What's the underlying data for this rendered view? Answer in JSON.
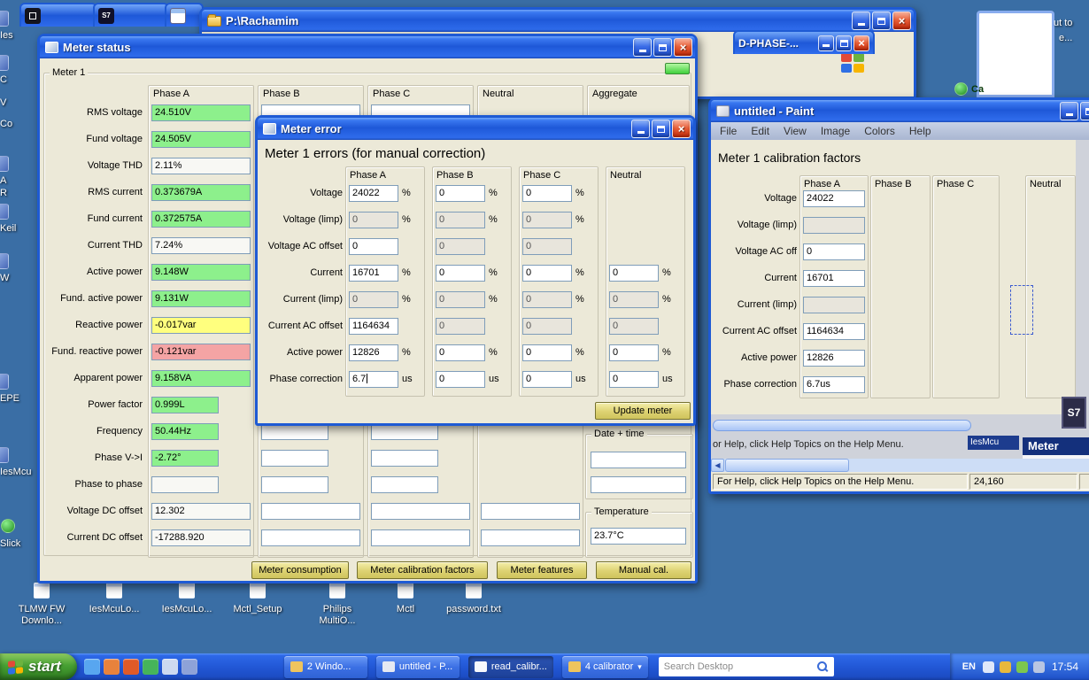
{
  "colors": {
    "titlebar_blue": "#2b6cec",
    "desktop_blue": "#3a6ea5",
    "field_green": "#8df08c",
    "field_yellow": "#ffff7e",
    "field_red": "#f4a4a4",
    "button_gold": "#ddd272",
    "led_green": "#3fd03c",
    "taskbar_blue": "#2258d6",
    "start_green": "#47a033"
  },
  "desktop": {
    "left_icons": [
      {
        "label": "Ies"
      },
      {
        "label": "C"
      },
      {
        "label": "V"
      },
      {
        "label": "Co"
      },
      {
        "label": "A"
      },
      {
        "label": "R"
      },
      {
        "label": "Keil"
      },
      {
        "label": "W"
      },
      {
        "label": "EPE"
      },
      {
        "label": "IesMcu"
      },
      {
        "label": "Slick"
      }
    ],
    "bottom_icons": [
      {
        "label": "TLMW FW\nDownlo..."
      },
      {
        "label": "IesMcuLo..."
      },
      {
        "label": "IesMcuLo..."
      },
      {
        "label": "Mctl_Setup"
      },
      {
        "label": "Philips\nMultiO..."
      },
      {
        "label": "Mctl"
      },
      {
        "label": "password.txt"
      }
    ],
    "corner_labels": [
      "ut to",
      "e..."
    ],
    "ca_icon_label": "Ca"
  },
  "explorer": {
    "title": "P:\\Rachamim"
  },
  "dphase": {
    "title": "D-PHASE-..."
  },
  "meter_status": {
    "title": "Meter status",
    "group_label": "Meter 1",
    "columns": [
      "Phase A",
      "Phase B",
      "Phase C",
      "Neutral",
      "Aggregate"
    ],
    "rows": [
      {
        "label": "RMS voltage",
        "value": "24.510V",
        "color": "green"
      },
      {
        "label": "Fund voltage",
        "value": "24.505V",
        "color": "green"
      },
      {
        "label": "Voltage THD",
        "value": "2.11%",
        "color": "white"
      },
      {
        "label": "RMS current",
        "value": "0.373679A",
        "color": "green"
      },
      {
        "label": "Fund current",
        "value": "0.372575A",
        "color": "green"
      },
      {
        "label": "Current THD",
        "value": "7.24%",
        "color": "white"
      },
      {
        "label": "Active power",
        "value": "9.148W",
        "color": "green"
      },
      {
        "label": "Fund. active power",
        "value": "9.131W",
        "color": "green"
      },
      {
        "label": "Reactive power",
        "value": "-0.017var",
        "color": "yellow"
      },
      {
        "label": "Fund. reactive power",
        "value": "-0.121var",
        "color": "red"
      },
      {
        "label": "Apparent power",
        "value": "9.158VA",
        "color": "green"
      },
      {
        "label": "Power factor",
        "value": "0.999L",
        "color": "green",
        "narrow": true
      },
      {
        "label": "Frequency",
        "value": "50.44Hz",
        "color": "green",
        "narrow": true
      },
      {
        "label": "Phase V->I",
        "value": "-2.72°",
        "color": "green",
        "narrow": true
      },
      {
        "label": "Phase to phase",
        "value": "",
        "color": "white",
        "narrow": true
      },
      {
        "label": "Voltage DC offset",
        "value": "12.302",
        "color": "white"
      },
      {
        "label": "Current DC offset",
        "value": "-17288.920",
        "color": "white"
      }
    ],
    "date_time_label": "Date + time",
    "temperature_label": "Temperature",
    "temperature_value": "23.7°C",
    "buttons": [
      "Meter consumption",
      "Meter calibration factors",
      "Meter features",
      "Manual cal."
    ]
  },
  "meter_error": {
    "title": "Meter error",
    "heading": "Meter 1 errors (for manual correction)",
    "columns": [
      "Phase A",
      "Phase B",
      "Phase C",
      "Neutral"
    ],
    "rows": [
      {
        "label": "Voltage",
        "suffix": "%",
        "cells": [
          "24022",
          "0",
          "0",
          null
        ]
      },
      {
        "label": "Voltage (limp)",
        "suffix": "%",
        "muted": [
          0,
          1,
          2
        ],
        "cells": [
          "0",
          "0",
          "0",
          null
        ]
      },
      {
        "label": "Voltage AC offset",
        "suffix": "",
        "muted": [
          1,
          2
        ],
        "cells": [
          "0",
          "0",
          "0",
          null
        ]
      },
      {
        "label": "Current",
        "suffix": "%",
        "cells": [
          "16701",
          "0",
          "0",
          "0"
        ]
      },
      {
        "label": "Current (limp)",
        "suffix": "%",
        "muted": [
          0,
          1,
          2,
          3
        ],
        "cells": [
          "0",
          "0",
          "0",
          "0"
        ]
      },
      {
        "label": "Current AC offset",
        "suffix": "",
        "muted": [
          1,
          2,
          3
        ],
        "cells": [
          "1164634",
          "0",
          "0",
          "0"
        ]
      },
      {
        "label": "Active power",
        "suffix": "%",
        "cells": [
          "12826",
          "0",
          "0",
          "0"
        ]
      },
      {
        "label": "Phase correction",
        "suffix": "us",
        "caret": 0,
        "cells": [
          "6.7",
          "0",
          "0",
          "0"
        ]
      }
    ],
    "update_button": "Update meter"
  },
  "paint": {
    "title": "untitled - Paint",
    "menus": [
      "File",
      "Edit",
      "View",
      "Image",
      "Colors",
      "Help"
    ],
    "image": {
      "heading": "Meter 1 calibration factors",
      "columns": [
        "Phase A",
        "Phase B",
        "Phase C",
        "Neutral"
      ],
      "rows": [
        {
          "label": "Voltage",
          "value": "24022"
        },
        {
          "label": "Voltage (limp)",
          "value": "",
          "muted": true
        },
        {
          "label": "Voltage AC off",
          "value": "0"
        },
        {
          "label": "Current",
          "value": "16701"
        },
        {
          "label": "Current (limp)",
          "value": "",
          "muted": true
        },
        {
          "label": "Current AC offset",
          "value": "1164634"
        },
        {
          "label": "Active power",
          "value": "12826"
        },
        {
          "label": "Phase correction",
          "value": "6.7us"
        }
      ],
      "partial_status": "or Help, click Help Topics on the Help Menu.",
      "fragment_label": "IesMcu",
      "fragment_title": "Meter",
      "fragment_logo": "S7"
    },
    "status_left": "For Help, click Help Topics on the Help Menu.",
    "status_right": "24,160"
  },
  "taskbar": {
    "start_label": "start",
    "quick_launch": [
      {
        "name": "internet-explorer-icon",
        "color": "#58a6f0"
      },
      {
        "name": "media-player-icon",
        "color": "#e8823c"
      },
      {
        "name": "firefox-icon",
        "color": "#e05a28"
      },
      {
        "name": "messenger-icon",
        "color": "#46b45a"
      },
      {
        "name": "show-desktop-icon",
        "color": "#cdd9f0"
      },
      {
        "name": "app-icon",
        "color": "#8ea2d8"
      }
    ],
    "tasks": [
      {
        "label": "2 Windo...",
        "icon": "folder-icon"
      },
      {
        "label": "untitled - P...",
        "icon": "paint-icon"
      },
      {
        "label": "read_calibr...",
        "icon": "document-icon",
        "active": true
      },
      {
        "label": "4 calibrator",
        "icon": "group-icon",
        "dropdown": true
      }
    ],
    "search_placeholder": "Search Desktop",
    "tray_icons": [
      {
        "name": "volume-icon",
        "color": "#dfe8fa"
      },
      {
        "name": "security-icon",
        "color": "#e8b83c"
      },
      {
        "name": "network-icon",
        "color": "#7cc64e"
      },
      {
        "name": "usb-icon",
        "color": "#b9c6e2"
      }
    ],
    "tray": {
      "lang": "EN",
      "time": "17:54"
    }
  }
}
